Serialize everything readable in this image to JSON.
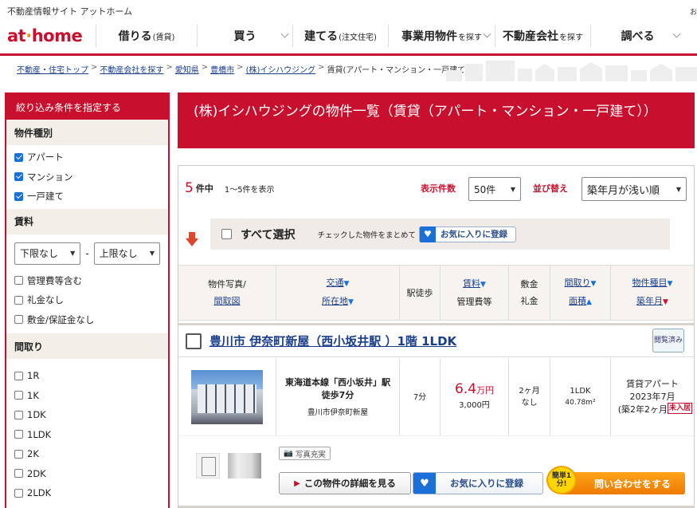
{
  "site_tagline": "不動産情報サイト アットホーム",
  "site_tagline_right": "お",
  "logo": {
    "pre": "at",
    "dot": "·",
    "post": "home"
  },
  "nav": [
    {
      "label": "借りる",
      "sub": "(賃貸)"
    },
    {
      "label": "買う",
      "sub": ""
    },
    {
      "label": "建てる",
      "sub": "(注文住宅)"
    },
    {
      "label": "事業用物件",
      "sub": "を探す"
    },
    {
      "label": "不動産会社",
      "sub": "を探す"
    },
    {
      "label": "調べる",
      "sub": ""
    }
  ],
  "breadcrumb": [
    {
      "label": "不動産・住宅トップ",
      "link": true
    },
    {
      "label": "不動産会社を探す",
      "link": true
    },
    {
      "label": "愛知県",
      "link": true
    },
    {
      "label": "豊橋市",
      "link": true
    },
    {
      "label": "(株)イシハウジング",
      "link": true
    },
    {
      "label": "賃貸(アパート・マンション・一戸建て)",
      "link": false
    }
  ],
  "sidebar": {
    "header": "絞り込み条件を指定する",
    "type_section": "物件種別",
    "types": [
      {
        "label": "アパート",
        "checked": true
      },
      {
        "label": "マンション",
        "checked": true
      },
      {
        "label": "一戸建て",
        "checked": true
      }
    ],
    "rent_section": "賃料",
    "rent_min": "下限なし",
    "rent_tilde": "-",
    "rent_max": "上限なし",
    "rent_options": [
      "管理費等含む",
      "礼金なし",
      "敷金/保証金なし"
    ],
    "layout_section": "間取り",
    "layouts": [
      "1R",
      "1K",
      "1DK",
      "1LDK",
      "2K",
      "2DK",
      "2LDK"
    ]
  },
  "main": {
    "title": "(株)イシハウジングの物件一覧（賃貸（アパート・マンション・一戸建て））",
    "count": "5",
    "count_unit": "件中",
    "range": "1〜5件を表示",
    "display_label": "表示件数",
    "display_value": "50件",
    "sort_label": "並び替え",
    "sort_value": "築年月が浅い順",
    "select_all": "すべて選択",
    "select_note": "チェックした物件をまとめて",
    "fav_register": "お気に入りに登録"
  },
  "table_headers": {
    "photo1": "物件写真/",
    "photo2": "間取図",
    "traffic": "交通",
    "location": "所在地",
    "walk": "駅徒歩",
    "rent": "賃料",
    "mgmt": "管理費等",
    "deposit": "敷金",
    "key_money": "礼金",
    "layout": "間取り",
    "area": "面積",
    "type": "物件種目",
    "built": "築年月"
  },
  "property": {
    "title": "豊川市 伊奈町新屋（西小坂井駅 ）1階 1LDK",
    "viewed": "閲覧済み",
    "line": "東海道本線「西小坂井」駅 徒歩7分",
    "address": "豊川市伊奈町新屋",
    "walk": "7分",
    "rent_value": "6.4",
    "rent_unit": "万円",
    "mgmt_fee": "3,000円",
    "deposit": "2ヶ月",
    "key_money": "なし",
    "layout": "1LDK",
    "area": "40.78m²",
    "type": "賃貸アパート",
    "built": "2023年7月",
    "age": "(築2年2ヶ月)",
    "new_badge": "未入居",
    "photo_tag": "写真充実",
    "detail_btn": "この物件の詳細を見る",
    "fav_btn": "お気に入りに登録",
    "inquiry_btn": "問い合わせをする",
    "easy_badge": "簡単1分!"
  }
}
